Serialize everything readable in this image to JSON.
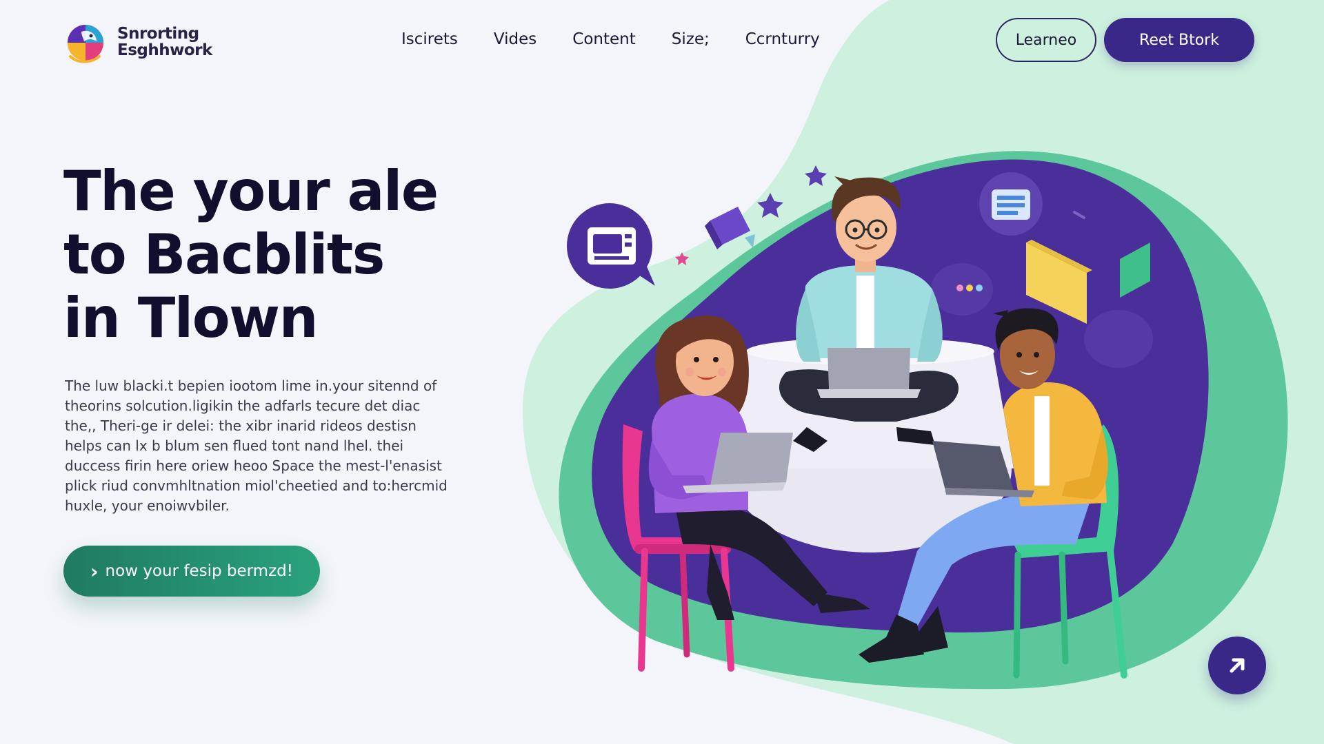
{
  "brand": {
    "name_line1": "Snrorting",
    "name_line2": "Esghhwork",
    "logo_icon": "multicolor-bird-logo"
  },
  "nav": {
    "items": [
      {
        "label": "Iscirets"
      },
      {
        "label": "Vides"
      },
      {
        "label": "Content"
      },
      {
        "label": "Size;"
      },
      {
        "label": "Ccrnturry"
      }
    ]
  },
  "header_actions": {
    "secondary_label": "Learneo",
    "primary_label": "Reet Btork"
  },
  "hero": {
    "title_lines": [
      "The your ale",
      "to Bacblits",
      "in Tlown"
    ],
    "body_lines": [
      "The luw blacki.t bepien iootom lime in.your sitennd of",
      "theorins solcution.ligikin the adfarls tecure det diac",
      "the,, Theri-ge ir delei: the xibr inarid rideos destisn",
      "helps can lx b blum sen flued tont nand lhel. thei",
      "duccess firin here oriew heoo Space the mest-l'enasist",
      "plick riud convmhltnation miol'cheetied and to:hercmid",
      "huxle, your enoiwvbiler."
    ],
    "cta_label": "now your fesip bermzd!",
    "cta_icon": "chevron-right-icon"
  },
  "fab": {
    "icon": "arrow-up-right-icon"
  },
  "colors": {
    "background": "#f3f5fa",
    "primary": "#3a2889",
    "accent_green": "#2aa27e",
    "mint": "#c9f0dc",
    "blob_purple": "#4a2f9a",
    "blob_green": "#5cc79a",
    "text_dark": "#120f2e"
  }
}
